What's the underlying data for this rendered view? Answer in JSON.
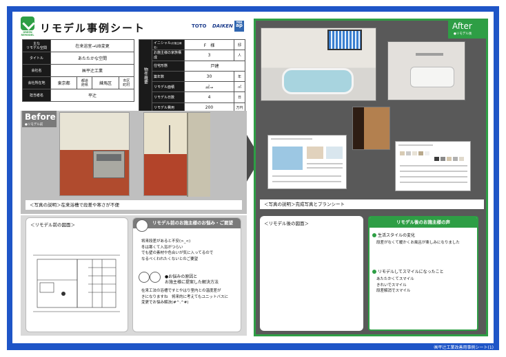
{
  "header": {
    "title": "リモデル事例シート",
    "logo_text": "GREEN REMODEL",
    "brands": [
      "TOTO",
      "DAIKEN",
      "YKK",
      "ap"
    ]
  },
  "project": {
    "rows": [
      {
        "label": "主な\nリモデル空間",
        "value": "在来浴室→UB変更"
      },
      {
        "label": "タイトル",
        "value": "あたたかな空間"
      },
      {
        "label": "会社名",
        "value": "㈱平辻工業"
      },
      {
        "label": "会社所在地",
        "pref": "東京都",
        "pref_unit": "都道\n府県",
        "city": "練馬区",
        "city_unit": "市区\n町村"
      },
      {
        "label": "担当者名",
        "value": "平辻"
      }
    ]
  },
  "property": {
    "side_label": "物件概要",
    "initial_label": "イニシャル",
    "initial_note": "(お施主様名)",
    "initial_value": "F　様",
    "initial_unit": "邸",
    "family_label": "お施主様の家族構成",
    "family_value": "3",
    "family_unit": "人",
    "type_label": "住宅形態",
    "type_value": "戸建",
    "age_label": "築年数",
    "age_value": "30",
    "age_unit": "年",
    "area_label": "リモデル面積",
    "area_value": "㎡→",
    "area_unit": "㎡",
    "days_label": "リモデル日数",
    "days_value": "4",
    "days_unit": "日",
    "cost_label": "リモデル費用",
    "cost_value": "200",
    "cost_unit": "万円"
  },
  "before": {
    "badge": "Before",
    "badge_sub": "●リモデル前",
    "caption": "＜写真の説明＞在来浴槽で段差や寒さが不便",
    "plan_label": "＜リモデル前の図面＞",
    "concern_title": "リモデル前のお施主様のお悩み・ご要望",
    "concern_lines": [
      "将来段差があると不安(>_<)",
      "冬は寒くて入浴がつらい",
      "でも壁の素材や色合いが気に入ってるので",
      "なるべくわれたくないとのご要望"
    ],
    "cause_title_1": "お悩みの原因と",
    "cause_title_2": "お施主様に提案した解決方法",
    "cause_lines": [
      "在来工法の浴槽ですとやはり室内との温度差が",
      "きになりますね　将来的に考えてもユニットバスに",
      "変更でお悩み解決(#^.^#)"
    ]
  },
  "after": {
    "badge": "After",
    "badge_sub": "●リモデル後",
    "caption": "＜写真の説明＞完成写真とプランシート",
    "plan_label": "＜リモデル後の図面＞",
    "voice_title": "リモデル後のお施主様の声",
    "voice_1_title": "生活スタイルの変化",
    "voice_1_body": [
      "段差がなくて暖かくお風呂が楽しみになりました"
    ],
    "voice_2_title": "リモデルしてスマイルになったこと",
    "voice_2_body": [
      "あたたかくてスマイル",
      "きれいでスマイル",
      "段差解消でスマイル"
    ]
  },
  "footer": {
    "text": "㈱平辻工業改善用事例シート(1)"
  },
  "colors": {
    "frame": "#1e55c7",
    "green": "#2e9e45",
    "dark": "#1a1a1a"
  }
}
